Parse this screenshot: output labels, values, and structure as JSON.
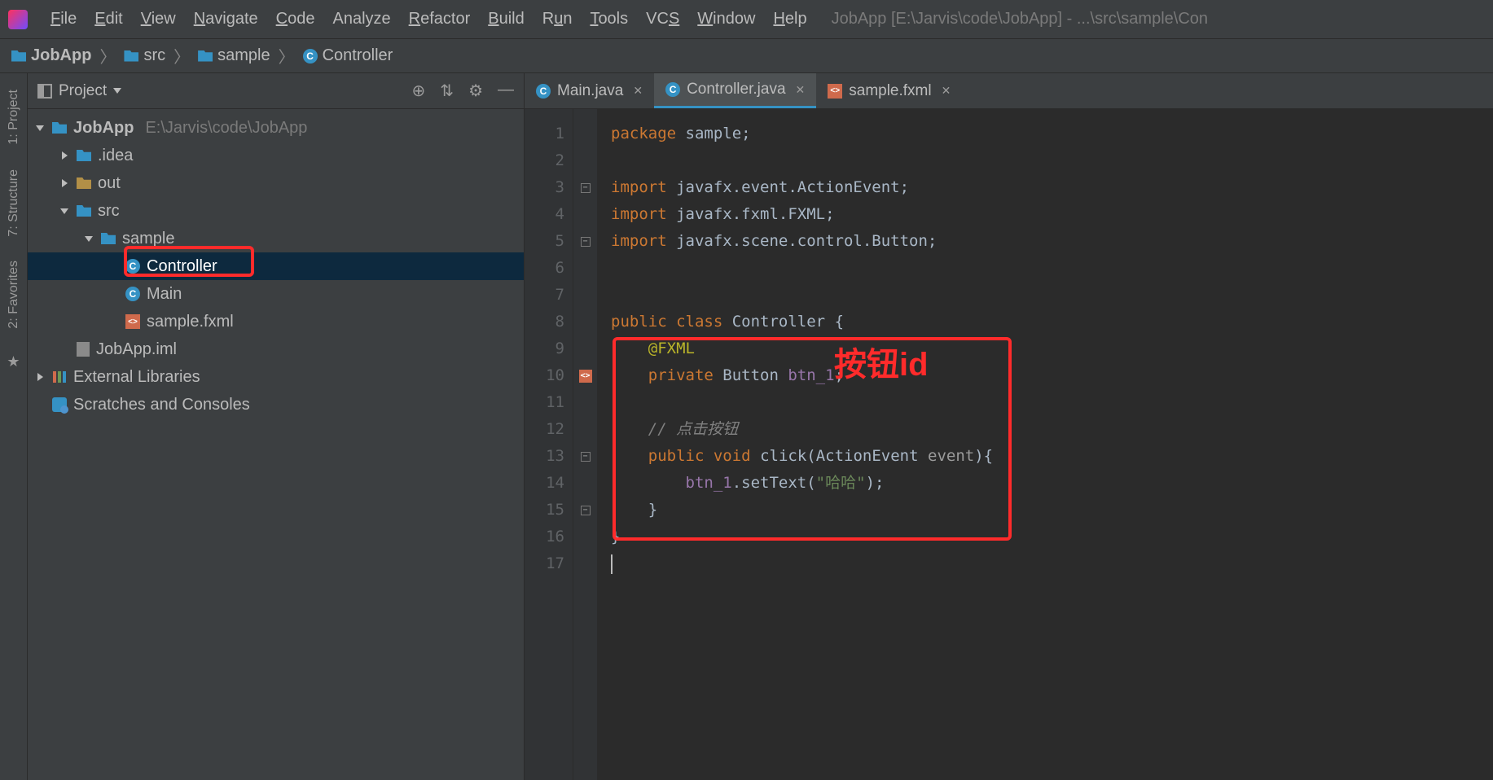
{
  "menu": {
    "items": [
      "File",
      "Edit",
      "View",
      "Navigate",
      "Code",
      "Analyze",
      "Refactor",
      "Build",
      "Run",
      "Tools",
      "VCS",
      "Window",
      "Help"
    ],
    "underlines": [
      "F",
      "E",
      "V",
      "N",
      "C",
      "",
      "R",
      "B",
      "u",
      "T",
      "S",
      "W",
      "H"
    ]
  },
  "window_title": "JobApp [E:\\Jarvis\\code\\JobApp] - ...\\src\\sample\\Con",
  "breadcrumb": [
    {
      "icon": "folder",
      "label": "JobApp"
    },
    {
      "icon": "folder",
      "label": "src"
    },
    {
      "icon": "folder",
      "label": "sample"
    },
    {
      "icon": "class",
      "label": "Controller"
    }
  ],
  "left_tabs": [
    "1: Project",
    "7: Structure",
    "2: Favorites"
  ],
  "project_panel": {
    "title": "Project",
    "toolbar": [
      "locate-icon",
      "collapse-icon",
      "settings-icon",
      "minimize-icon"
    ],
    "tree": [
      {
        "depth": 0,
        "arrow": "open",
        "icon": "folder",
        "label": "JobApp",
        "dim": "E:\\Jarvis\\code\\JobApp",
        "selected": false
      },
      {
        "depth": 1,
        "arrow": "closed",
        "icon": "folder",
        "label": ".idea"
      },
      {
        "depth": 1,
        "arrow": "closed",
        "icon": "folder-orange",
        "label": "out"
      },
      {
        "depth": 1,
        "arrow": "open",
        "icon": "folder",
        "label": "src"
      },
      {
        "depth": 2,
        "arrow": "open",
        "icon": "folder",
        "label": "sample"
      },
      {
        "depth": 3,
        "arrow": "none",
        "icon": "class",
        "label": "Controller",
        "selected": true,
        "highlight": true
      },
      {
        "depth": 3,
        "arrow": "none",
        "icon": "class",
        "label": "Main"
      },
      {
        "depth": 3,
        "arrow": "none",
        "icon": "fxml",
        "label": "sample.fxml"
      },
      {
        "depth": 1,
        "arrow": "none",
        "icon": "file",
        "label": "JobApp.iml"
      },
      {
        "depth": 0,
        "arrow": "closed",
        "icon": "lib",
        "label": "External Libraries"
      },
      {
        "depth": 0,
        "arrow": "none",
        "icon": "scratch",
        "label": "Scratches and Consoles"
      }
    ]
  },
  "editor_tabs": [
    {
      "icon": "class",
      "label": "Main.java",
      "active": false
    },
    {
      "icon": "class",
      "label": "Controller.java",
      "active": true
    },
    {
      "icon": "fxml",
      "label": "sample.fxml",
      "active": false
    }
  ],
  "code": {
    "lines": [
      {
        "n": 1,
        "html": "<span class='kw'>package</span> sample;"
      },
      {
        "n": 2,
        "html": ""
      },
      {
        "n": 3,
        "html": "<span class='kw'>import</span> javafx.event.ActionEvent;",
        "fold": "open"
      },
      {
        "n": 4,
        "html": "<span class='kw'>import</span> javafx.fxml.FXML;"
      },
      {
        "n": 5,
        "html": "<span class='kw'>import</span> javafx.scene.control.Button;",
        "fold": "close"
      },
      {
        "n": 6,
        "html": ""
      },
      {
        "n": 7,
        "html": ""
      },
      {
        "n": 8,
        "html": "<span class='kw'>public</span> <span class='kw'>class</span> Controller {"
      },
      {
        "n": 9,
        "html": "    <span class='ann'>@FXML</span>"
      },
      {
        "n": 10,
        "html": "    <span class='kw'>private</span> Button <span class='fld'>btn_1</span>;",
        "mark": "fxml"
      },
      {
        "n": 11,
        "html": ""
      },
      {
        "n": 12,
        "html": "    <span class='cm'>// 点击按钮</span>"
      },
      {
        "n": 13,
        "html": "    <span class='kw'>public</span> <span class='kw'>void</span> <span class='id'>click</span>(ActionEvent <span class='pr'>event</span>){",
        "fold": "open"
      },
      {
        "n": 14,
        "html": "        <span class='fld'>btn_1</span>.setText(<span class='str'>\"哈哈\"</span>);"
      },
      {
        "n": 15,
        "html": "    }",
        "fold": "close"
      },
      {
        "n": 16,
        "html": "}"
      },
      {
        "n": 17,
        "html": "<span class='caret'></span>"
      }
    ]
  },
  "annotations": {
    "red_box_tree": "Controller",
    "red_box_code_label": "按钮id"
  }
}
